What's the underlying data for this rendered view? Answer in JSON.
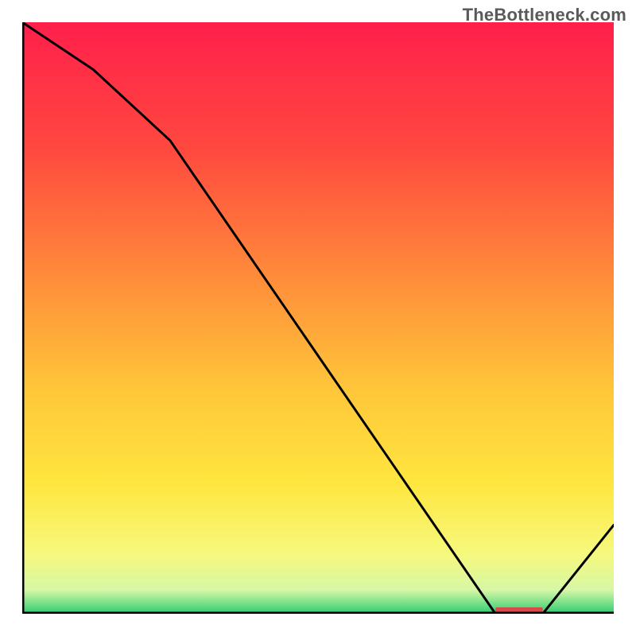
{
  "watermark": "TheBottleneck.com",
  "chart_data": {
    "type": "line",
    "title": "",
    "xlabel": "",
    "ylabel": "",
    "xlim": [
      0,
      100
    ],
    "ylim": [
      0,
      100
    ],
    "x": [
      0,
      12,
      25,
      80,
      88,
      100
    ],
    "values": [
      100,
      92,
      80,
      0,
      0,
      15
    ],
    "highlight_band_x": [
      80,
      88
    ],
    "gradient_stops": [
      {
        "pos": 0.0,
        "color": "#ff1f4b"
      },
      {
        "pos": 0.22,
        "color": "#ff4a3f"
      },
      {
        "pos": 0.45,
        "color": "#ff923a"
      },
      {
        "pos": 0.62,
        "color": "#ffc63a"
      },
      {
        "pos": 0.78,
        "color": "#ffe63f"
      },
      {
        "pos": 0.9,
        "color": "#f6f97e"
      },
      {
        "pos": 0.96,
        "color": "#d6f7a6"
      },
      {
        "pos": 1.0,
        "color": "#2ecc71"
      }
    ],
    "axes_color": "#000000",
    "line_color": "#000000",
    "highlight_color": "#d94a4a"
  }
}
